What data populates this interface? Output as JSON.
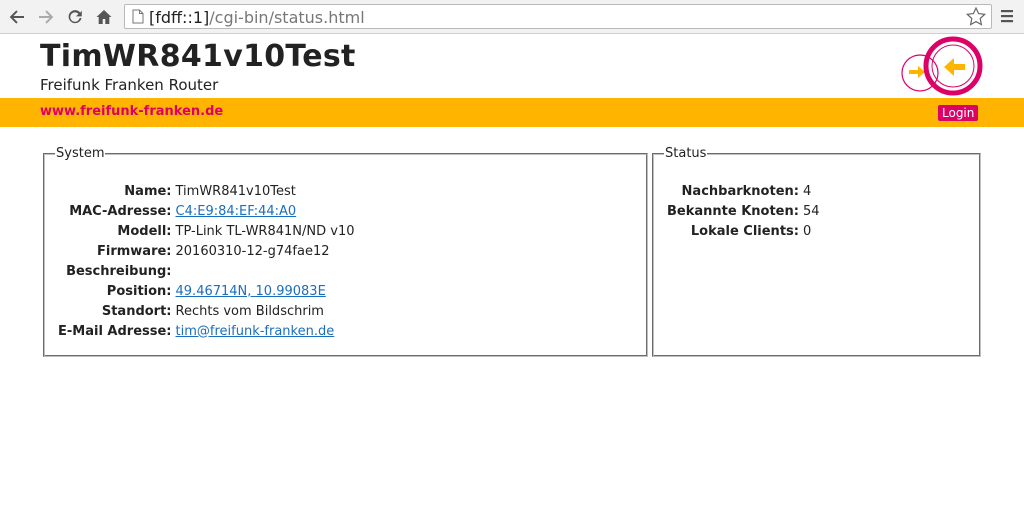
{
  "browser": {
    "url_host": "[fdff::1]",
    "url_path": "/cgi-bin/status.html"
  },
  "header": {
    "title": "TimWR841v10Test",
    "subtitle": "Freifunk Franken Router",
    "site_link": "www.freifunk-franken.de",
    "login_label": "Login"
  },
  "system": {
    "legend": "System",
    "rows": [
      {
        "label": "Name:",
        "value": "TimWR841v10Test"
      },
      {
        "label": "MAC-Adresse:",
        "value": "C4:E9:84:EF:44:A0"
      },
      {
        "label": "Modell:",
        "value": "TP-Link TL-WR841N/ND v10"
      },
      {
        "label": "Firmware:",
        "value": "20160310-12-g74fae12"
      },
      {
        "label": "Beschreibung:",
        "value": ""
      },
      {
        "label": "Position:",
        "value": "49.46714N, 10.99083E"
      },
      {
        "label": "Standort:",
        "value": "Rechts vom Bildschrim"
      },
      {
        "label": "E-Mail Adresse:",
        "value": "tim@freifunk-franken.de"
      }
    ]
  },
  "status": {
    "legend": "Status",
    "rows": [
      {
        "label": "Nachbarknoten:",
        "value": "4"
      },
      {
        "label": "Bekannte Knoten:",
        "value": "54"
      },
      {
        "label": "Lokale Clients:",
        "value": "0"
      }
    ]
  },
  "colors": {
    "accent_orange": "#ffb400",
    "brand_magenta": "#dc0067",
    "link_blue": "#1a6fbe"
  },
  "icons": [
    "back-arrow-icon",
    "forward-arrow-icon",
    "reload-icon",
    "home-icon",
    "page-icon",
    "star-icon",
    "menu-icon",
    "freifunk-logo"
  ]
}
